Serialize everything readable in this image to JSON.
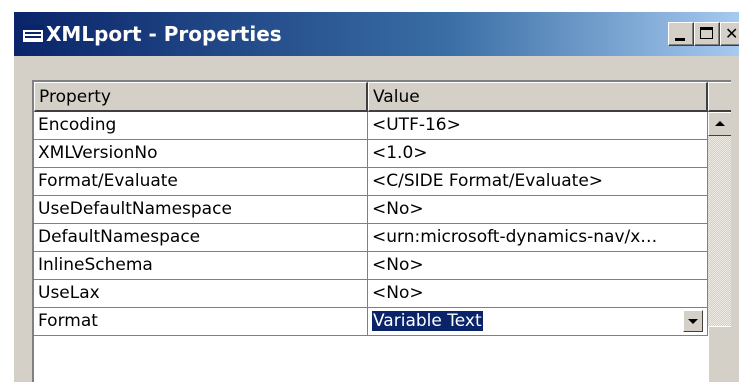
{
  "window": {
    "title": "XMLport - Properties"
  },
  "grid": {
    "headers": {
      "property": "Property",
      "value": "Value"
    },
    "rows": [
      {
        "property": "Encoding",
        "value": "<UTF-16>"
      },
      {
        "property": "XMLVersionNo",
        "value": "<1.0>"
      },
      {
        "property": "Format/Evaluate",
        "value": "<C/SIDE Format/Evaluate>"
      },
      {
        "property": "UseDefaultNamespace",
        "value": "<No>"
      },
      {
        "property": "DefaultNamespace",
        "value": "<urn:microsoft-dynamics-nav/x…"
      },
      {
        "property": "InlineSchema",
        "value": "<No>"
      },
      {
        "property": "UseLax",
        "value": "<No>"
      },
      {
        "property": "Format",
        "value": "Variable Text"
      }
    ]
  },
  "colors": {
    "titlebar_start": "#0a246a",
    "titlebar_end": "#a6caf0",
    "selection": "#0a246a",
    "window_face": "#d4d0c8"
  },
  "icons": {
    "app": "table-icon",
    "minimize": "minimize-icon",
    "maximize": "maximize-icon",
    "close": "close-icon",
    "dropdown": "chevron-down-icon",
    "scroll_up": "scroll-up-arrow-icon"
  }
}
